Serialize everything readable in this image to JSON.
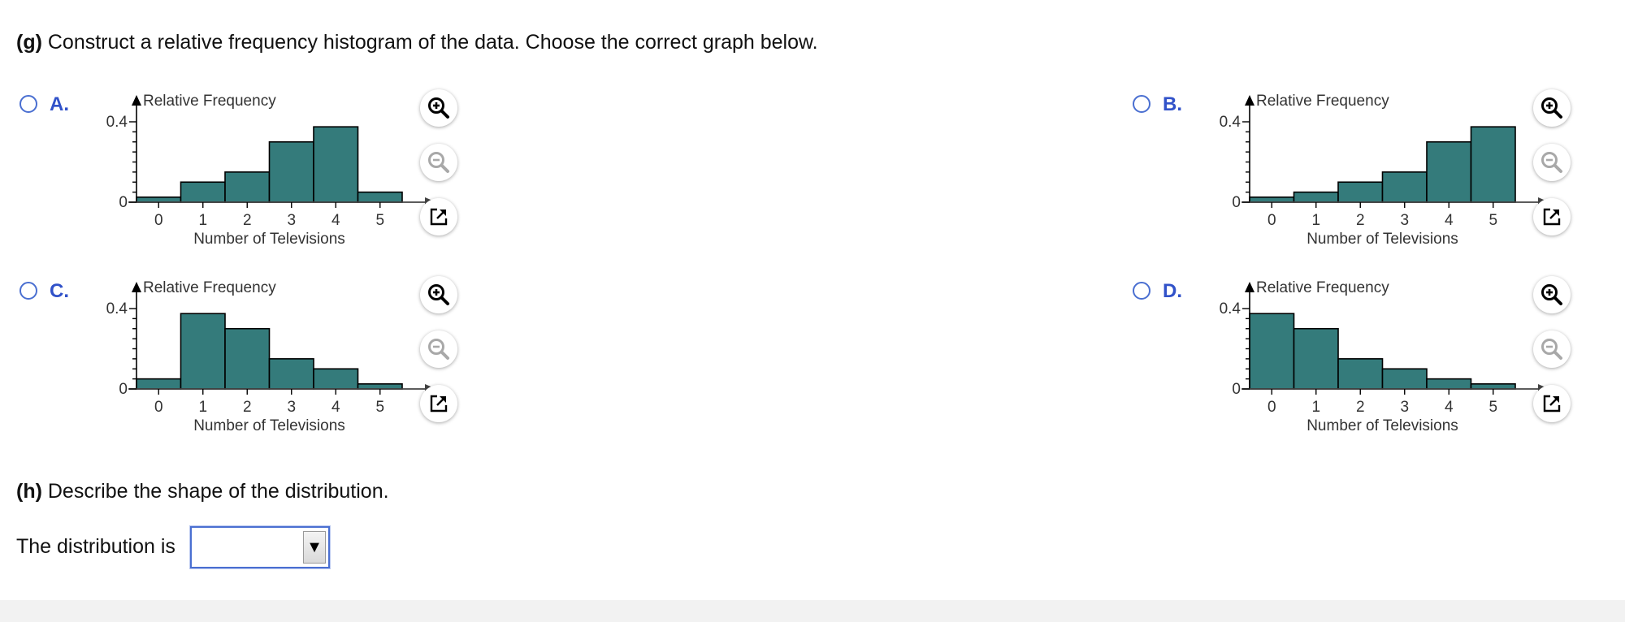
{
  "question_g": {
    "label": "(g)",
    "text": " Construct a relative frequency histogram of the data. Choose the correct graph below."
  },
  "axis_labels": {
    "y": "Relative Frequency",
    "x": "Number of Televisions",
    "y_ticks": [
      "0.4",
      "0"
    ],
    "x_ticks": [
      "0",
      "1",
      "2",
      "3",
      "4",
      "5"
    ]
  },
  "options": [
    {
      "letter": "A.",
      "selected": false
    },
    {
      "letter": "B.",
      "selected": false
    },
    {
      "letter": "C.",
      "selected": false
    },
    {
      "letter": "D.",
      "selected": false
    }
  ],
  "tool_icons": [
    "zoom-in-icon",
    "zoom-out-icon",
    "popout-icon"
  ],
  "colors": {
    "bar_fill": "#347b7b",
    "accent": "#3152c9",
    "radio_border": "#4a6fd1"
  },
  "chart_data": [
    {
      "type": "bar",
      "ylabel": "Relative Frequency",
      "xlabel": "Number of Televisions",
      "categories": [
        0,
        1,
        2,
        3,
        4,
        5
      ],
      "values": [
        0.025,
        0.1,
        0.15,
        0.3,
        0.375,
        0.05
      ],
      "ylim": [
        0,
        0.4
      ],
      "yticks": [
        0,
        0.4
      ]
    },
    {
      "type": "bar",
      "ylabel": "Relative Frequency",
      "xlabel": "Number of Televisions",
      "categories": [
        0,
        1,
        2,
        3,
        4,
        5
      ],
      "values": [
        0.025,
        0.05,
        0.1,
        0.15,
        0.3,
        0.375
      ],
      "ylim": [
        0,
        0.4
      ],
      "yticks": [
        0,
        0.4
      ]
    },
    {
      "type": "bar",
      "ylabel": "Relative Frequency",
      "xlabel": "Number of Televisions",
      "categories": [
        0,
        1,
        2,
        3,
        4,
        5
      ],
      "values": [
        0.05,
        0.375,
        0.3,
        0.15,
        0.1,
        0.025
      ],
      "ylim": [
        0,
        0.4
      ],
      "yticks": [
        0,
        0.4
      ]
    },
    {
      "type": "bar",
      "ylabel": "Relative Frequency",
      "xlabel": "Number of Televisions",
      "categories": [
        0,
        1,
        2,
        3,
        4,
        5
      ],
      "values": [
        0.375,
        0.3,
        0.15,
        0.1,
        0.05,
        0.025
      ],
      "ylim": [
        0,
        0.4
      ],
      "yticks": [
        0,
        0.4
      ]
    }
  ],
  "question_h": {
    "label": "(h)",
    "text": " Describe the shape of the distribution."
  },
  "distribution": {
    "label": "The distribution is",
    "selected_value": "",
    "arrow": "▼"
  }
}
